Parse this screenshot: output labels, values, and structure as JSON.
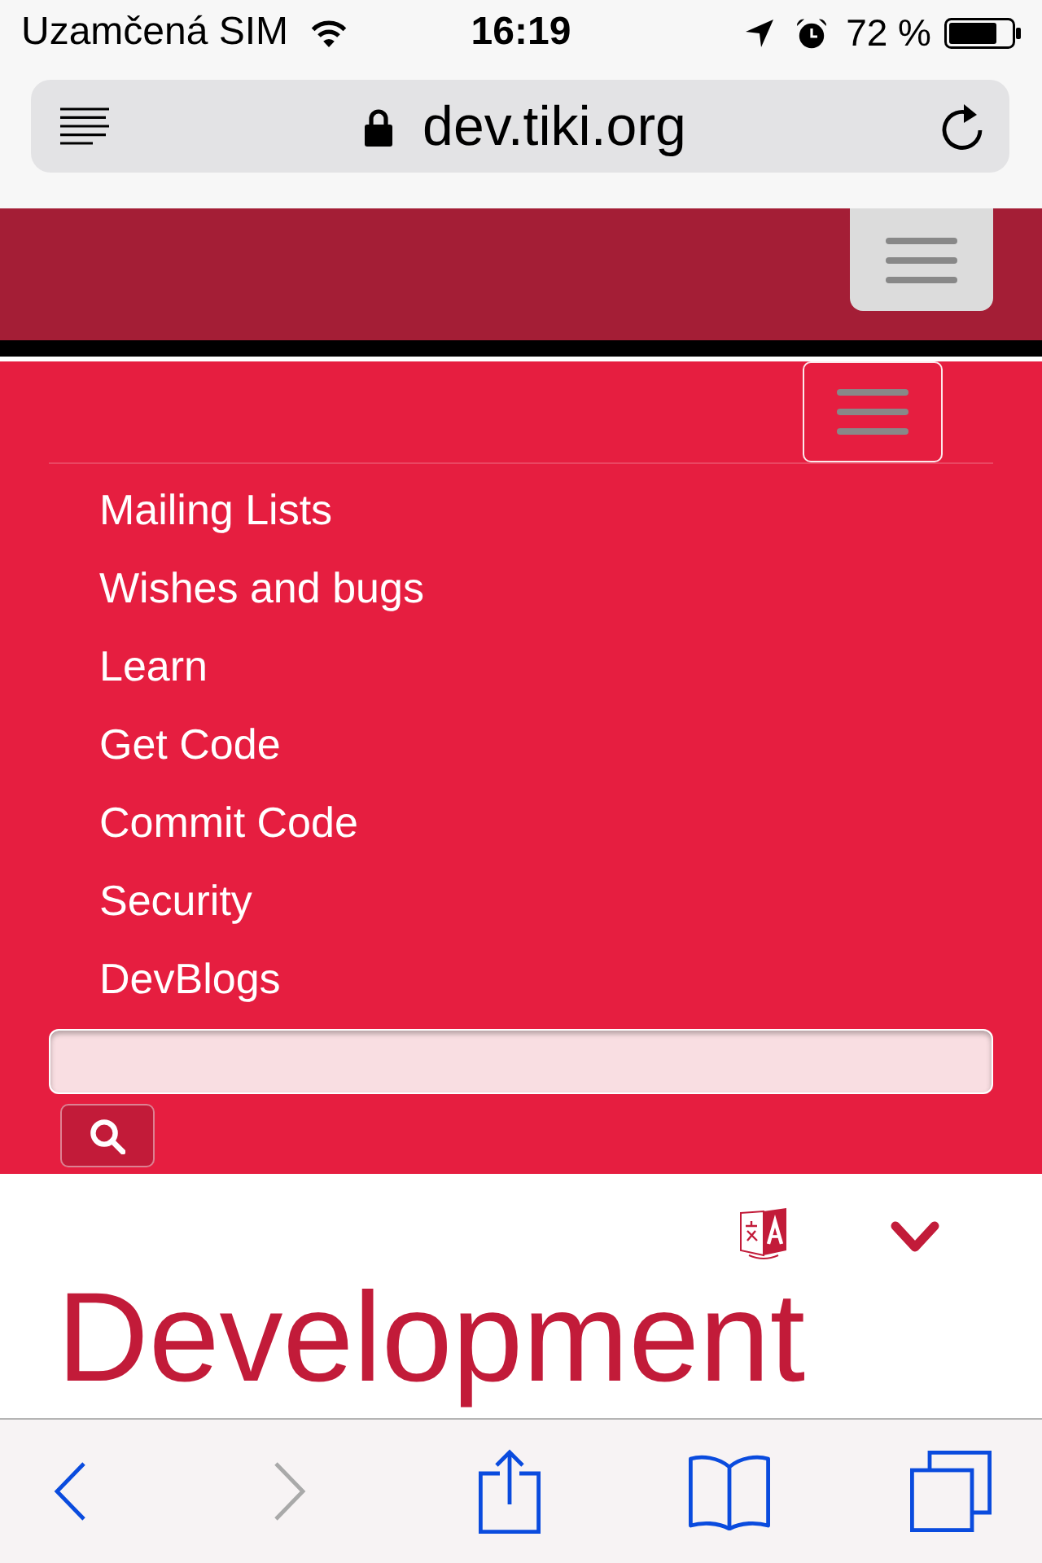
{
  "status_bar": {
    "carrier": "Uzamčená SIM",
    "time": "16:19",
    "battery": "72 %"
  },
  "address_bar": {
    "url": "dev.tiki.org"
  },
  "nav_menu": {
    "items": [
      {
        "label": "Mailing Lists"
      },
      {
        "label": "Wishes and bugs"
      },
      {
        "label": "Learn"
      },
      {
        "label": "Get Code"
      },
      {
        "label": "Commit Code"
      },
      {
        "label": "Security"
      },
      {
        "label": "DevBlogs"
      }
    ]
  },
  "page": {
    "title": "Development"
  },
  "toolbar": {
    "buttons": [
      {
        "kind": "back",
        "disabled": false
      },
      {
        "kind": "forward",
        "disabled": true
      },
      {
        "kind": "share",
        "disabled": false
      },
      {
        "kind": "bookmarks",
        "disabled": false
      },
      {
        "kind": "tabs",
        "disabled": false
      }
    ]
  }
}
